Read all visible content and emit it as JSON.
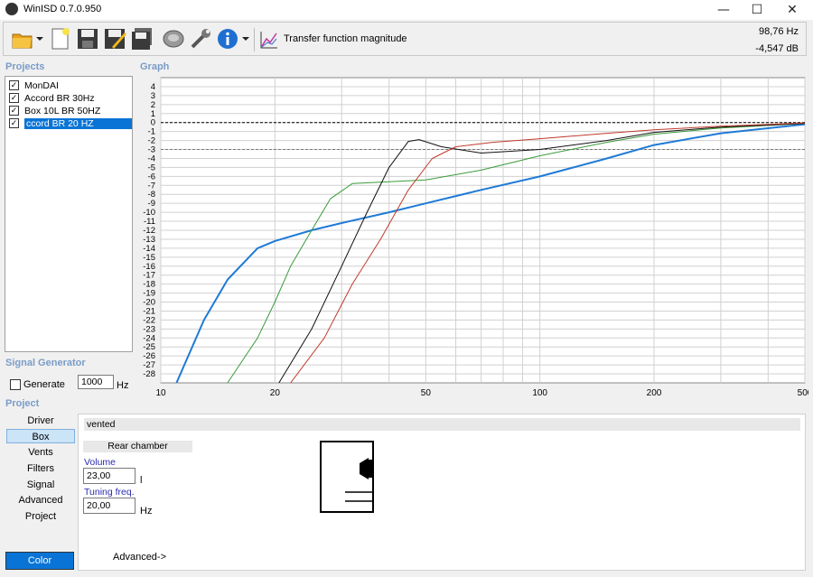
{
  "window": {
    "title": "WinISD 0.7.0.950",
    "minimize": "—",
    "maximize": "☐",
    "close": "✕"
  },
  "toolbar": {
    "icons": [
      "open-folder-icon",
      "new-document-icon",
      "save-icon",
      "save-edit-icon",
      "save-all-icon",
      "driver-icon",
      "wrench-icon",
      "info-icon"
    ],
    "graph_type_label": "Transfer function magnitude",
    "readout_freq": "98,76 Hz",
    "readout_db": "-4,547 dB"
  },
  "projects": {
    "header": "Projects",
    "items": [
      {
        "label": "MonDAI",
        "checked": true,
        "selected": false
      },
      {
        "label": "Accord BR 30Hz",
        "checked": true,
        "selected": false
      },
      {
        "label": "Box 10L BR 50HZ",
        "checked": true,
        "selected": false
      },
      {
        "label": "ccord BR 20 HZ",
        "checked": true,
        "selected": true
      }
    ]
  },
  "graph": {
    "header": "Graph",
    "y_ticks": [
      "4",
      "3",
      "2",
      "1",
      "0",
      "-1",
      "-2",
      "-3",
      "-4",
      "-5",
      "-6",
      "-7",
      "-8",
      "-9",
      "-10",
      "-11",
      "-12",
      "-13",
      "-14",
      "-15",
      "-16",
      "-17",
      "-18",
      "-19",
      "-20",
      "-21",
      "-22",
      "-23",
      "-24",
      "-25",
      "-26",
      "-27",
      "-28"
    ],
    "x_ticks": [
      "10",
      "20",
      "50",
      "100",
      "200",
      "500"
    ]
  },
  "chart_data": {
    "type": "line",
    "title": "",
    "xlabel": "",
    "ylabel": "",
    "x_scale": "log",
    "xlim": [
      10,
      500
    ],
    "ylim": [
      -29,
      5
    ],
    "grid": true,
    "reference_lines": [
      0,
      -3
    ],
    "series": [
      {
        "color": "#1f7ad6",
        "points": [
          [
            11,
            -29
          ],
          [
            13,
            -22
          ],
          [
            15,
            -17.5
          ],
          [
            18,
            -14
          ],
          [
            20,
            -13.2
          ],
          [
            25,
            -12
          ],
          [
            30,
            -11.2
          ],
          [
            40,
            -10
          ],
          [
            50,
            -9
          ],
          [
            70,
            -7.5
          ],
          [
            100,
            -6
          ],
          [
            150,
            -4
          ],
          [
            200,
            -2.5
          ],
          [
            300,
            -1.2
          ],
          [
            500,
            -0.2
          ]
        ]
      },
      {
        "color": "#3a9a3a",
        "points": [
          [
            15,
            -29
          ],
          [
            18,
            -24
          ],
          [
            20,
            -20
          ],
          [
            22,
            -16
          ],
          [
            25,
            -12
          ],
          [
            28,
            -8.5
          ],
          [
            32,
            -6.8
          ],
          [
            40,
            -6.6
          ],
          [
            50,
            -6.4
          ],
          [
            70,
            -5.3
          ],
          [
            100,
            -3.7
          ],
          [
            150,
            -2.2
          ],
          [
            200,
            -1.3
          ],
          [
            300,
            -0.6
          ],
          [
            500,
            -0.1
          ]
        ]
      },
      {
        "color": "#111111",
        "points": [
          [
            20.5,
            -29
          ],
          [
            25,
            -23
          ],
          [
            30,
            -16
          ],
          [
            35,
            -10
          ],
          [
            40,
            -5
          ],
          [
            45,
            -2.1
          ],
          [
            48,
            -1.9
          ],
          [
            55,
            -2.7
          ],
          [
            70,
            -3.4
          ],
          [
            100,
            -3
          ],
          [
            150,
            -2
          ],
          [
            200,
            -1.1
          ],
          [
            300,
            -0.5
          ],
          [
            500,
            -0.1
          ]
        ]
      },
      {
        "color": "#c0392b",
        "points": [
          [
            22,
            -29
          ],
          [
            27,
            -24
          ],
          [
            32,
            -18
          ],
          [
            38,
            -13
          ],
          [
            45,
            -7.5
          ],
          [
            52,
            -4
          ],
          [
            60,
            -2.7
          ],
          [
            75,
            -2.2
          ],
          [
            100,
            -1.8
          ],
          [
            150,
            -1.2
          ],
          [
            200,
            -0.8
          ],
          [
            300,
            -0.4
          ],
          [
            500,
            -0.05
          ]
        ]
      }
    ]
  },
  "signal_generator": {
    "header": "Signal Generator",
    "generate_label": "Generate",
    "generate_checked": false,
    "frequency": "1000",
    "unit": "Hz"
  },
  "project_nav": {
    "header": "Project",
    "items": [
      "Driver",
      "Box",
      "Vents",
      "Filters",
      "Signal",
      "Advanced",
      "Project"
    ],
    "selected": "Box",
    "color_button": "Color",
    "color": "#0a74d6"
  },
  "box_panel": {
    "type_label": "vented",
    "rear_chamber": "Rear chamber",
    "volume_label": "Volume",
    "volume_value": "23,00",
    "volume_unit": "l",
    "tuning_label": "Tuning freq.",
    "tuning_value": "20,00",
    "tuning_unit": "Hz",
    "advanced_link": "Advanced->"
  }
}
